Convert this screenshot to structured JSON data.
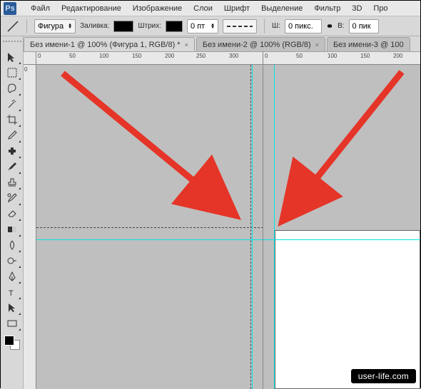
{
  "app": {
    "logo": "Ps"
  },
  "menu": {
    "file": "Файл",
    "edit": "Редактирование",
    "image": "Изображение",
    "layers": "Слои",
    "type": "Шрифт",
    "select": "Выделение",
    "filter": "Фильтр",
    "threeD": "3D",
    "view": "Про"
  },
  "options": {
    "shape_mode": "Фигура",
    "fill_label": "Заливка:",
    "stroke_label": "Штрих:",
    "stroke_width": "0 пт",
    "w_label": "Ш:",
    "w_value": "0 пикс.",
    "b_label": "В:",
    "b_value": "0 пик"
  },
  "tabs": {
    "t1": "Без имени-1 @ 100% (Фигура 1, RGB/8) *",
    "t2": "Без имени-2 @ 100% (RGB/8)",
    "t3": "Без имени-3 @ 100"
  },
  "ruler": {
    "h": {
      "r0": "0",
      "r50": "50",
      "r100": "100",
      "r150": "150",
      "r200": "200",
      "r250": "250",
      "r300": "300"
    },
    "h2": {
      "r0": "0",
      "r50": "50",
      "r100": "100",
      "r150": "150",
      "r200": "200"
    },
    "v": {
      "r0": "0"
    }
  },
  "watermark": "user-life.com"
}
